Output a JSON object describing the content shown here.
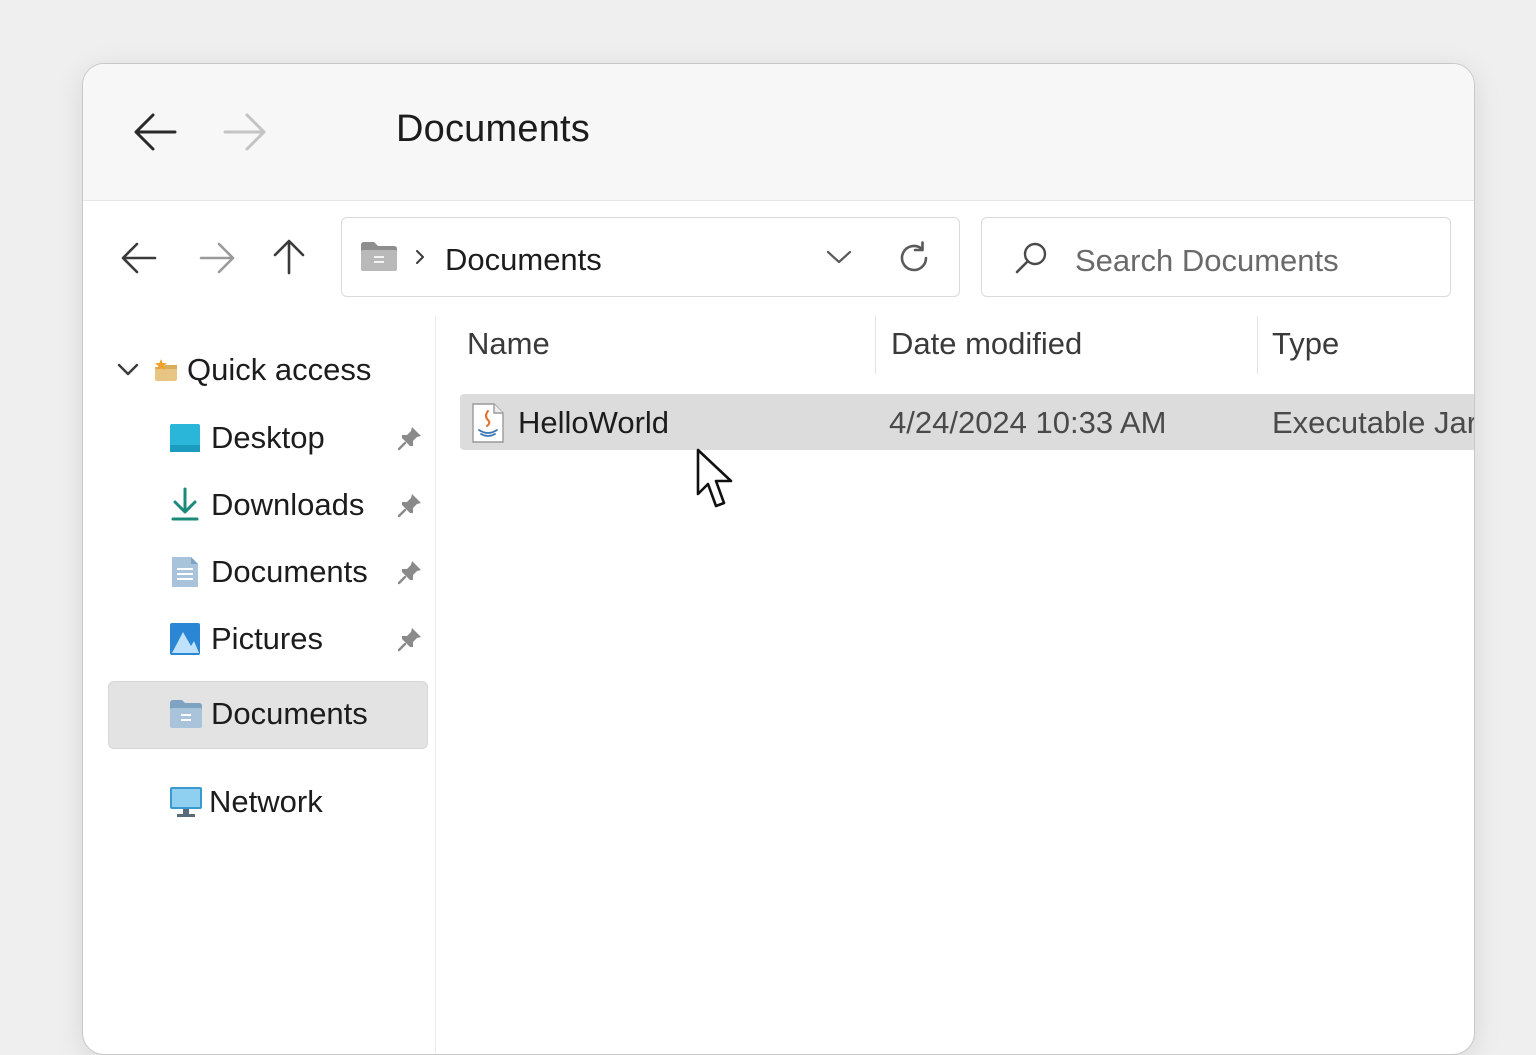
{
  "window": {
    "title": "Documents"
  },
  "toolbar": {
    "address_folder": "Documents",
    "search_placeholder": "Search Documents"
  },
  "nav": {
    "quick_access": "Quick access",
    "items": [
      {
        "label": "Desktop",
        "icon": "desktop-icon",
        "pinned": true
      },
      {
        "label": "Downloads",
        "icon": "downloads-icon",
        "pinned": true
      },
      {
        "label": "Documents",
        "icon": "documents-icon",
        "pinned": true
      },
      {
        "label": "Pictures",
        "icon": "pictures-icon",
        "pinned": true
      }
    ],
    "selected": "Documents",
    "network": "Network"
  },
  "file_list": {
    "columns": [
      "Name",
      "Date modified",
      "Type"
    ],
    "rows": [
      {
        "name": "HelloWorld",
        "date_modified": "4/24/2024 10:33 AM",
        "type": "Executable Jar",
        "icon": "java-jar-icon",
        "selected": true
      }
    ]
  },
  "colors": {
    "selection": "#dcdcdc",
    "nav_selected": "#e3e3e3",
    "desktop_icon": "#29b6d9",
    "downloads_icon": "#1c8a7a",
    "pictures_icon": "#2b86d6"
  }
}
